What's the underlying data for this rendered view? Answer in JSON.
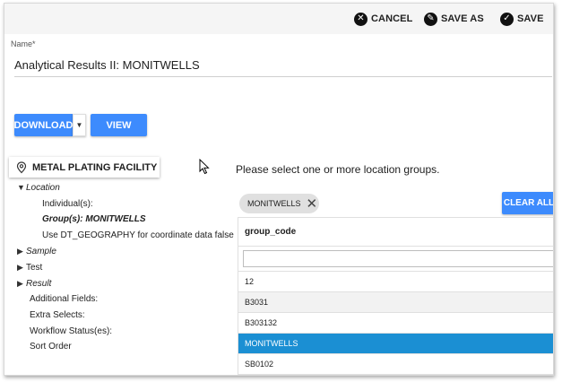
{
  "toolbar": {
    "cancel_label": "CANCEL",
    "save_as_label": "SAVE AS",
    "save_label": "SAVE"
  },
  "form": {
    "name_label": "Name",
    "name_required": "*",
    "name_value": "Analytical Results II: MONITWELLS"
  },
  "actions": {
    "download_label": "DOWNLOAD",
    "view_label": "VIEW"
  },
  "facility": {
    "label": "METAL PLATING FACILITY"
  },
  "tree": {
    "location": "Location",
    "individuals": "Individual(s):",
    "groups": "Group(s): MONITWELLS",
    "dt_geography": "Use DT_GEOGRAPHY for coordinate data false",
    "sample": "Sample",
    "test": "Test",
    "result": "Result",
    "additional_fields": "Additional Fields:",
    "extra_selects": "Extra Selects:",
    "workflow_status": "Workflow Status(es):",
    "sort_order": "Sort Order"
  },
  "groups_panel": {
    "prompt": "Please select one or more location groups.",
    "chip_label": "MONITWELLS",
    "clear_all_label": "CLEAR ALL",
    "column_header": "group_code",
    "rows": [
      "12",
      "B3031",
      "B303132",
      "MONITWELLS",
      "SB0102"
    ],
    "selected_row": "MONITWELLS"
  },
  "colors": {
    "accent": "#3d8bfd",
    "selected_row": "#1b8fd3"
  }
}
